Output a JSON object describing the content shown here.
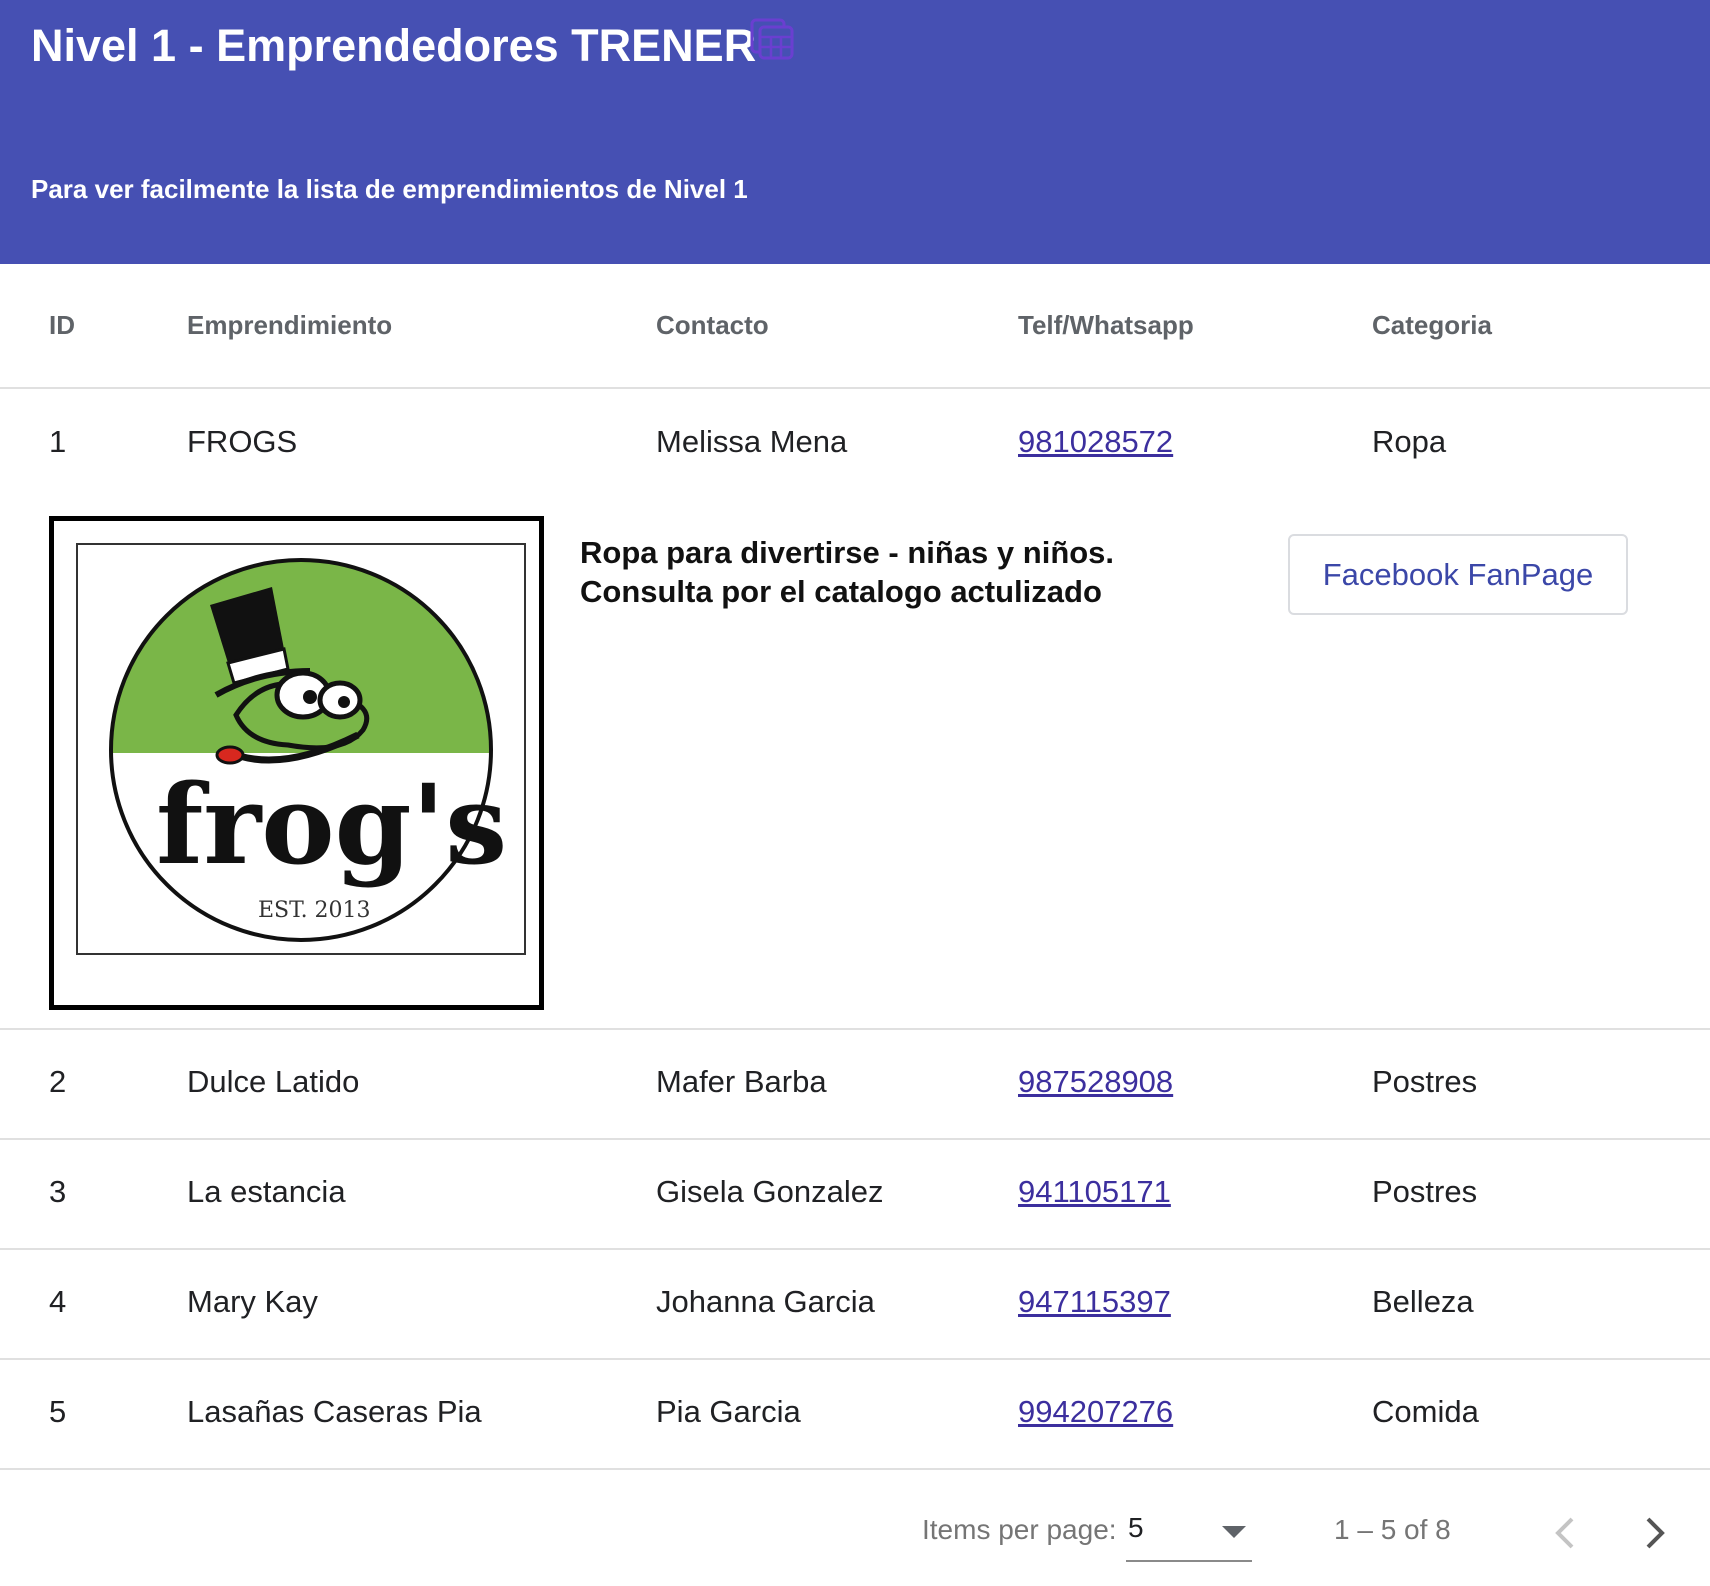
{
  "header": {
    "title": "Nivel 1 - Emprendedores TRENER",
    "subtitle": "Para ver facilmente la lista de emprendimientos de Nivel 1",
    "icon": "spreadsheet-icon",
    "background_color": "#4650b3"
  },
  "table": {
    "columns": [
      "ID",
      "Emprendimiento",
      "Contacto",
      "Telf/Whatsapp",
      "Categoria"
    ],
    "rows": [
      {
        "id": "1",
        "emprendimiento": "FROGS",
        "contacto": "Melissa Mena",
        "telefono": "981028572",
        "categoria": "Ropa"
      },
      {
        "id": "2",
        "emprendimiento": "Dulce Latido",
        "contacto": "Mafer Barba",
        "telefono": "987528908",
        "categoria": "Postres"
      },
      {
        "id": "3",
        "emprendimiento": "La estancia",
        "contacto": "Gisela Gonzalez",
        "telefono": "941105171",
        "categoria": "Postres"
      },
      {
        "id": "4",
        "emprendimiento": "Mary Kay",
        "contacto": "Johanna Garcia",
        "telefono": "947115397",
        "categoria": "Belleza"
      },
      {
        "id": "5",
        "emprendimiento": "Lasañas Caseras Pia",
        "contacto": "Pia Garcia",
        "telefono": "994207276",
        "categoria": "Comida"
      }
    ]
  },
  "detail": {
    "logo_text": "frog's",
    "logo_est": "EST. 2013",
    "description_line1": "Ropa para divertirse - niñas y niños.",
    "description_line2": "Consulta por el catalogo actulizado",
    "button_label": "Facebook FanPage",
    "logo_green": "#7ab648"
  },
  "pagination": {
    "items_label": "Items per page:",
    "page_size": "5",
    "range": "1 – 5 of 8"
  }
}
